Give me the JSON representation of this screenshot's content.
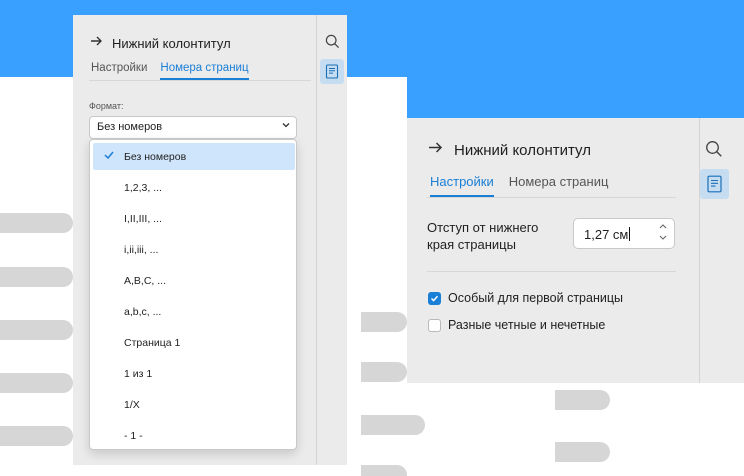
{
  "left_panel": {
    "title": "Нижний колонтитул",
    "tabs": [
      {
        "label": "Настройки",
        "active": false
      },
      {
        "label": "Номера страниц",
        "active": true
      }
    ],
    "format_label": "Формат:",
    "format_value": "Без номеров",
    "options": [
      {
        "label": "Без номеров",
        "selected": true
      },
      {
        "label": "1,2,3, ..."
      },
      {
        "label": "I,II,III, ..."
      },
      {
        "label": "i,ii,iii, ..."
      },
      {
        "label": "A,B,C, ..."
      },
      {
        "label": "a,b,c, ..."
      },
      {
        "label": "Страница 1"
      },
      {
        "label": "1 из 1"
      },
      {
        "label": "1/X"
      },
      {
        "label": "- 1 -"
      }
    ]
  },
  "right_panel": {
    "title": "Нижний колонтитул",
    "tabs": [
      {
        "label": "Настройки",
        "active": true
      },
      {
        "label": "Номера страниц",
        "active": false
      }
    ],
    "offset_label": "Отступ от нижнего края страницы",
    "offset_value": "1,27 см",
    "checkboxes": [
      {
        "label": "Особый для первой страницы",
        "checked": true
      },
      {
        "label": "Разные четные и нечетные",
        "checked": false
      }
    ]
  },
  "icons": {
    "back": "arrow-right-icon",
    "search": "search-icon",
    "header_footer": "page-footer-icon",
    "check": "checkmark-icon"
  },
  "colors": {
    "background_accent": "#3aa0ff",
    "active_tab": "#1a7fd6",
    "selection": "#cfe5fb"
  }
}
